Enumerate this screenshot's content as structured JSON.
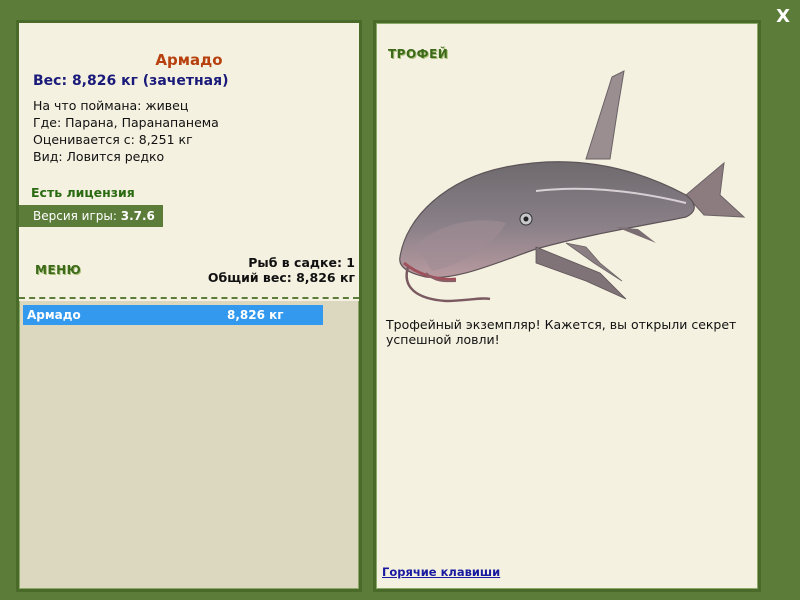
{
  "close_label": "X",
  "fish": {
    "name": "Армадо",
    "weight_line": "Вес: 8,826 кг (зачетная)",
    "caught_on": "На что поймана: живец",
    "where": "Где: Парана, Паранапанема",
    "valued_from": "Оценивается с: 8,251 кг",
    "kind": "Вид: Ловится редко"
  },
  "license": "Есть лицензия",
  "version": {
    "label": "Версия игры: ",
    "value": "3.7.6"
  },
  "menu_label": "МЕНЮ",
  "keepnet": {
    "count": "Рыб в садке: 1",
    "total": "Общий вес: 8,826 кг"
  },
  "catch_list": [
    {
      "name": "Армадо",
      "weight": "8,826 кг"
    }
  ],
  "trophy_label": "ТРОФЕЙ",
  "description": "Трофейный экземпляр! Кажется, вы открыли секрет успешной ловли!",
  "hotkeys_label": "Горячие клавиши",
  "colors": {
    "background": "#5c7d3a",
    "panel": "#f4f1e0",
    "accent_name": "#b7410e",
    "selection": "#3399ee"
  }
}
